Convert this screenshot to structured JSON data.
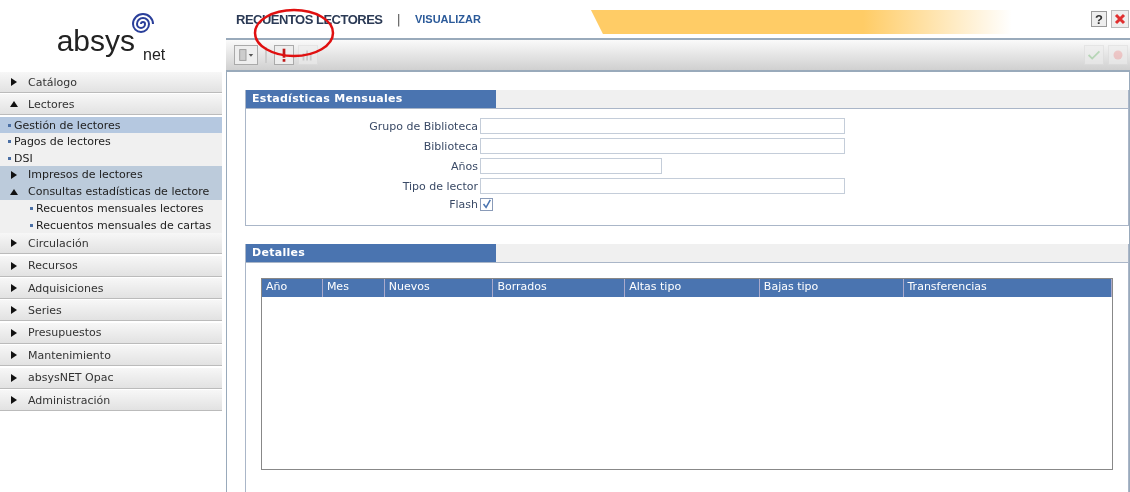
{
  "logo": {
    "name": "absys",
    "suffix": "net"
  },
  "sidebar": {
    "items": [
      {
        "label": "Catálogo",
        "kind": "section",
        "expanded": false
      },
      {
        "label": "Lectores",
        "kind": "section",
        "expanded": true,
        "children": [
          {
            "label": "Gestión de lectores",
            "kind": "link",
            "selected": true
          },
          {
            "label": "Pagos de lectores",
            "kind": "link",
            "selected": false
          },
          {
            "label": "DSI",
            "kind": "link",
            "selected": false
          },
          {
            "label": "Impresos de lectores",
            "kind": "subsection",
            "expanded": false
          },
          {
            "label": "Consultas estadísticas de lectore",
            "kind": "subsection",
            "expanded": true,
            "children": [
              {
                "label": "Recuentos mensuales lectores",
                "kind": "link",
                "selected": false
              },
              {
                "label": "Recuentos mensuales de cartas",
                "kind": "link",
                "selected": false
              }
            ]
          }
        ]
      },
      {
        "label": "Circulación",
        "kind": "section",
        "expanded": false
      },
      {
        "label": "Recursos",
        "kind": "section",
        "expanded": false
      },
      {
        "label": "Adquisiciones",
        "kind": "section",
        "expanded": false
      },
      {
        "label": "Series",
        "kind": "section",
        "expanded": false
      },
      {
        "label": "Presupuestos",
        "kind": "section",
        "expanded": false
      },
      {
        "label": "Mantenimiento",
        "kind": "section",
        "expanded": false
      },
      {
        "label": "absysNET Opac",
        "kind": "section",
        "expanded": false
      },
      {
        "label": "Administración",
        "kind": "section",
        "expanded": false
      }
    ]
  },
  "header": {
    "title": "RECUENTOS LECTORES",
    "separator": "|",
    "mode": "VISUALIZAR",
    "help": "?"
  },
  "stats_panel": {
    "title": "Estadísticas Mensuales",
    "fields": [
      {
        "label": "Grupo de Biblioteca",
        "kind": "text"
      },
      {
        "label": "Biblioteca",
        "kind": "text"
      },
      {
        "label": "Años",
        "kind": "short"
      },
      {
        "label": "Tipo de lector",
        "kind": "text"
      },
      {
        "label": "Flash",
        "kind": "checkbox",
        "checked": true
      }
    ]
  },
  "details_panel": {
    "title": "Detalles",
    "columns": [
      "Año",
      "Mes",
      "Nuevos",
      "Borrados",
      "Altas tipo",
      "Bajas tipo",
      "Transferencias"
    ]
  }
}
